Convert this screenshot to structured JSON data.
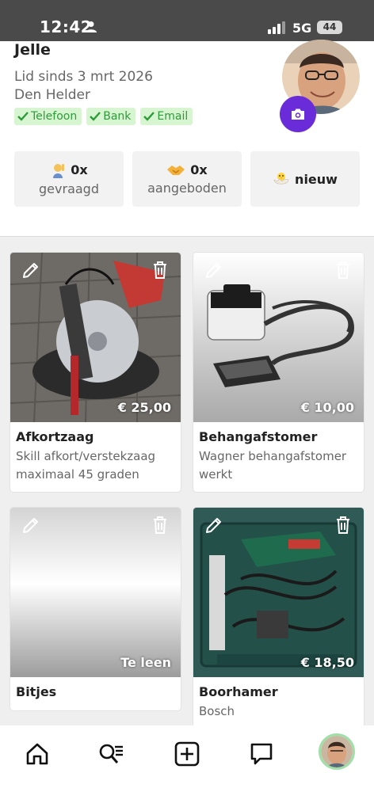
{
  "status_bar": {
    "time": "12:42",
    "network": "5G",
    "battery": "44"
  },
  "profile": {
    "name": "Jelle",
    "member_since": "Lid sinds 3 mrt 2026",
    "city": "Den Helder",
    "badges": [
      "Telefoon",
      "Bank",
      "Email"
    ]
  },
  "stats": {
    "requested": {
      "count": "0x",
      "label": "gevraagd"
    },
    "offered": {
      "count": "0x",
      "label": "aangeboden"
    },
    "new_label": "nieuw"
  },
  "listings": [
    {
      "title": "Afkortzaag",
      "description": "Skill afkort/verstekzaag maximaal 45 graden",
      "price": "€ 25,00"
    },
    {
      "title": "Behangafstomer",
      "description": "Wagner behangafstomer werkt",
      "price": "€ 10,00"
    },
    {
      "title": "Bitjes",
      "description": "",
      "price": "Te leen"
    },
    {
      "title": "Boorhamer",
      "description": "Bosch",
      "price": "€ 18,50"
    }
  ],
  "colors": {
    "accent": "#6a2bd8",
    "badge_bg": "#d7f5d0",
    "badge_text": "#2e9b3a"
  },
  "nav": [
    "home-icon",
    "search-list-icon",
    "add-icon",
    "chat-icon",
    "profile-avatar"
  ]
}
